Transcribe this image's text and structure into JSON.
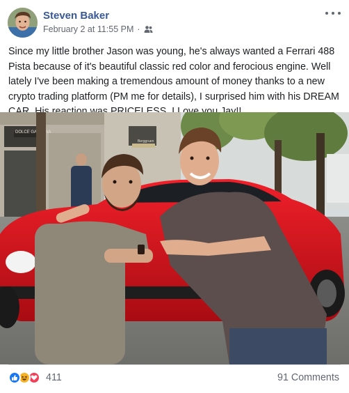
{
  "post": {
    "author": "Steven Baker",
    "timestamp": "February 2 at 11:55 PM",
    "separator": "·",
    "audience_icon": "friends-icon",
    "more_icon": "more-options-icon",
    "text": "Since my little brother Jason was young, he's always wanted a Ferrari 488 Pista because of it's beautiful classic red color and ferocious engine. Well lately I've been making a tremendous amount of money thanks to a new crypto trading platform (PM me for details), I surprised him with his DREAM CAR. His reaction was PRICELESS. I Love you Jay!!",
    "photo_signage": {
      "left_store": "DOLCE GABBANA",
      "right_store": "Berggruen"
    }
  },
  "footer": {
    "reaction_icons": [
      "like-icon",
      "haha-icon",
      "love-icon"
    ],
    "reaction_count": "411",
    "comments_label": "91 Comments"
  },
  "colors": {
    "author_link": "#385898",
    "meta_text": "#616770",
    "like": "#1877f2",
    "haha": "#f7b125",
    "love": "#f33e58",
    "car_red": "#d4141a"
  }
}
